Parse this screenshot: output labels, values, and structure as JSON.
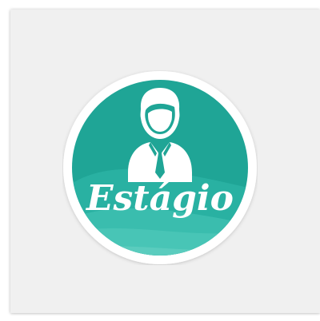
{
  "badge": {
    "label": "Estágio",
    "icon": "intern-person-icon",
    "colors": {
      "teal": "#1fa596",
      "teal_light": "#3dbfb0",
      "teal_dark": "#158c80",
      "ring": "#ffffff",
      "card_bg": "#f0f0f0"
    }
  }
}
